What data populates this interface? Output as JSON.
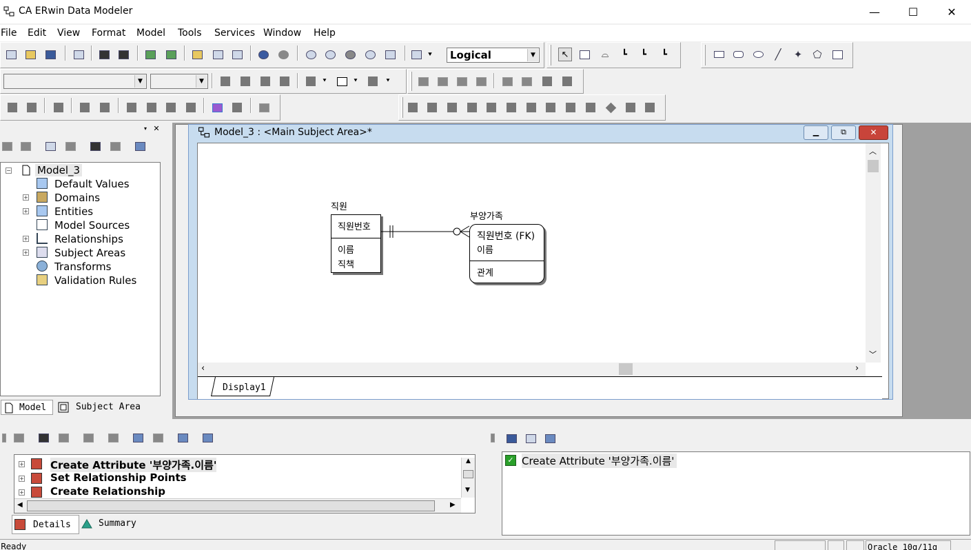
{
  "window": {
    "title": "CA ERwin Data Modeler",
    "minimize": "—",
    "maximize": "☐",
    "close": "✕"
  },
  "menu": [
    "File",
    "Edit",
    "View",
    "Format",
    "Model",
    "Tools",
    "Services",
    "Window",
    "Help"
  ],
  "toolbar": {
    "display_level": "Logical"
  },
  "tree": {
    "root": "Model_3",
    "items": [
      "Default Values",
      "Domains",
      "Entities",
      "Model Sources",
      "Relationships",
      "Subject Areas",
      "Transforms",
      "Validation Rules"
    ]
  },
  "left_tabs": {
    "model": "Model",
    "subject_area": "Subject Area"
  },
  "diagram_window": {
    "title": "Model_3 : <Main Subject Area>*",
    "tab": "Display1"
  },
  "entities": [
    {
      "name": "직원",
      "pk": [
        "직원번호"
      ],
      "attrs": [
        "이름",
        "직책"
      ]
    },
    {
      "name": "부양가족",
      "pk": [
        "직원번호 (FK)",
        "이름"
      ],
      "attrs": [
        "관계"
      ]
    }
  ],
  "actions": [
    "Create Attribute '부양가족.이름'",
    "Set Relationship Points",
    "Create Relationship"
  ],
  "bottom_tabs": {
    "details": "Details",
    "summary": "Summary"
  },
  "log": {
    "item": "Create Attribute '부양가족.이름'"
  },
  "status": {
    "text": "Ready",
    "db": "Oracle 10g/11g"
  }
}
